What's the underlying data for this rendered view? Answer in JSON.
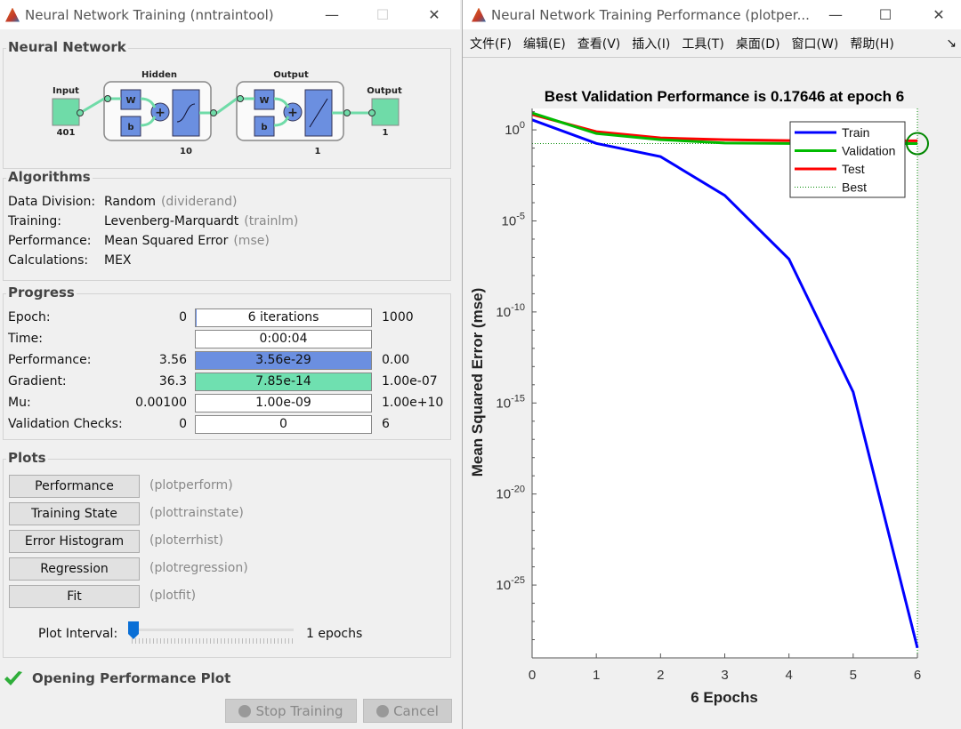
{
  "left_window": {
    "title": "Neural Network Training (nntraintool)",
    "controls": {
      "minimize": "—",
      "maximize": "☐",
      "close": "✕"
    },
    "network": {
      "group_label": "Neural Network",
      "input_label": "Input",
      "input_size": "401",
      "hidden_label": "Hidden",
      "hidden_size": "10",
      "output_layer_label": "Output",
      "output_layer_size": "1",
      "output_label": "Output",
      "output_size": "1",
      "w": "W",
      "b": "b",
      "colors": {
        "io": "#6fdba8",
        "block": "#6b8fe0"
      }
    },
    "algorithms": {
      "group_label": "Algorithms",
      "rows": [
        {
          "label": "Data Division:",
          "value": "Random",
          "hint": "(dividerand)"
        },
        {
          "label": "Training:",
          "value": "Levenberg-Marquardt",
          "hint": "(trainlm)"
        },
        {
          "label": "Performance:",
          "value": "Mean Squared Error",
          "hint": "(mse)"
        },
        {
          "label": "Calculations:",
          "value": "MEX",
          "hint": ""
        }
      ]
    },
    "progress": {
      "group_label": "Progress",
      "rows": [
        {
          "label": "Epoch:",
          "start": "0",
          "current": "6 iterations",
          "end": "1000",
          "fill": 0.006,
          "color": "#ffffff"
        },
        {
          "label": "Time:",
          "start": "",
          "current": "0:00:04",
          "end": "",
          "fill": 0,
          "color": "#ffffff"
        },
        {
          "label": "Performance:",
          "start": "3.56",
          "current": "3.56e-29",
          "end": "0.00",
          "fill": 1,
          "color": "#6b8fe0"
        },
        {
          "label": "Gradient:",
          "start": "36.3",
          "current": "7.85e-14",
          "end": "1.00e-07",
          "fill": 1,
          "color": "#6fe0b0"
        },
        {
          "label": "Mu:",
          "start": "0.00100",
          "current": "1.00e-09",
          "end": "1.00e+10",
          "fill": 0,
          "color": "#ffffff"
        },
        {
          "label": "Validation Checks:",
          "start": "0",
          "current": "0",
          "end": "6",
          "fill": 0,
          "color": "#ffffff"
        }
      ]
    },
    "plots": {
      "group_label": "Plots",
      "buttons": [
        {
          "label": "Performance",
          "hint": "(plotperform)"
        },
        {
          "label": "Training State",
          "hint": "(plottrainstate)"
        },
        {
          "label": "Error Histogram",
          "hint": "(ploterrhist)"
        },
        {
          "label": "Regression",
          "hint": "(plotregression)"
        },
        {
          "label": "Fit",
          "hint": "(plotfit)"
        }
      ],
      "interval_label": "Plot Interval:",
      "interval_value": "1 epochs",
      "interval_slider_fraction": 0
    },
    "status": {
      "icon": "check-icon",
      "text": "Opening Performance Plot"
    },
    "stop_button": "Stop Training",
    "cancel_button": "Cancel"
  },
  "right_window": {
    "title": "Neural Network Training Performance (plotper...",
    "controls": {
      "minimize": "—",
      "maximize": "☐",
      "close": "✕"
    },
    "menu": [
      "文件(F)",
      "编辑(E)",
      "查看(V)",
      "插入(I)",
      "工具(T)",
      "桌面(D)",
      "窗口(W)",
      "帮助(H)"
    ],
    "menu_overflow": "↘"
  },
  "chart_data": {
    "type": "line",
    "title": "Best Validation Performance is 0.17646 at epoch 6",
    "xlabel": "6 Epochs",
    "ylabel": "Mean Squared Error  (mse)",
    "yscale": "log",
    "xlim": [
      0,
      6
    ],
    "ylim": [
      1e-29,
      15
    ],
    "x": [
      0,
      1,
      2,
      3,
      4,
      5,
      6
    ],
    "x_ticks": [
      "0",
      "1",
      "2",
      "3",
      "4",
      "5",
      "6"
    ],
    "y_ticks": [
      {
        "exp": 0,
        "base": "10",
        "sup": "0"
      },
      {
        "exp": -5,
        "base": "10",
        "sup": "-5"
      },
      {
        "exp": -10,
        "base": "10",
        "sup": "-10"
      },
      {
        "exp": -15,
        "base": "10",
        "sup": "-15"
      },
      {
        "exp": -20,
        "base": "10",
        "sup": "-20"
      },
      {
        "exp": -25,
        "base": "10",
        "sup": "-25"
      }
    ],
    "series": [
      {
        "name": "Train",
        "color": "#0000ff",
        "values": [
          3.56,
          0.18,
          0.034,
          0.00025,
          8e-08,
          4e-15,
          3.56e-29
        ]
      },
      {
        "name": "Validation",
        "color": "#00bb00",
        "values": [
          8.5,
          0.63,
          0.29,
          0.19,
          0.18,
          0.177,
          0.17646
        ]
      },
      {
        "name": "Test",
        "color": "#ff0000",
        "values": [
          7,
          0.8,
          0.36,
          0.29,
          0.26,
          0.25,
          0.25
        ]
      }
    ],
    "best": {
      "name": "Best",
      "epoch": 6,
      "value": 0.17646,
      "color": "#008800"
    },
    "legend": "top-right",
    "grid": false
  }
}
